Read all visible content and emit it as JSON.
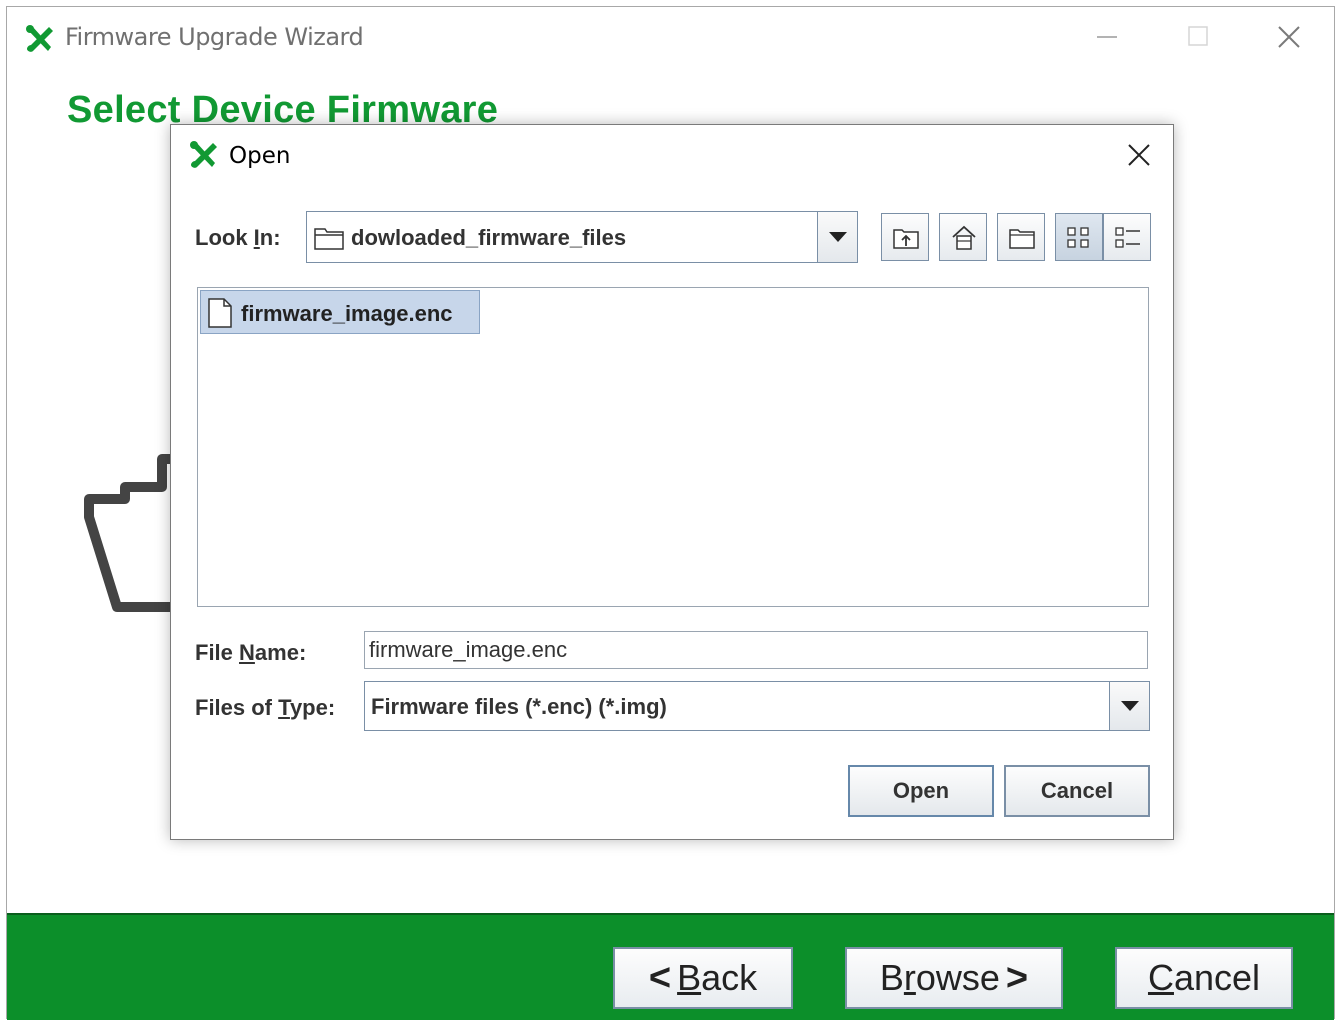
{
  "main_window": {
    "title": "Firmware Upgrade Wizard",
    "heading": "Select Device Firmware",
    "buttons": {
      "back_glyph": "<",
      "back_mnemonic": "B",
      "back_rest": "ack",
      "browse_start": "B",
      "browse_mnemonic": "r",
      "browse_rest": "owse",
      "browse_glyph": ">",
      "cancel_mnemonic": "C",
      "cancel_rest": "ancel"
    }
  },
  "dialog": {
    "title": "Open",
    "look_in": {
      "label_pre": "Look ",
      "label_mnemonic": "I",
      "label_post": "n:",
      "value": "dowloaded_firmware_files"
    },
    "files": [
      {
        "name": "firmware_image.enc",
        "selected": true
      }
    ],
    "file_name": {
      "label_pre": "File ",
      "label_mnemonic": "N",
      "label_post": "ame:",
      "value": "firmware_image.enc"
    },
    "files_of_type": {
      "label_pre": "Files of ",
      "label_mnemonic": "T",
      "label_post": "ype:",
      "value": "Firmware files (*.enc) (*.img)"
    },
    "buttons": {
      "open": "Open",
      "cancel": "Cancel"
    },
    "toolbar_icons": [
      "up-one-level-icon",
      "home-icon",
      "new-folder-icon",
      "list-view-icon",
      "details-view-icon"
    ]
  },
  "colors": {
    "brand_green": "#119933",
    "bottom_bar": "#0c8f2a",
    "selection": "#c7d6ea"
  }
}
